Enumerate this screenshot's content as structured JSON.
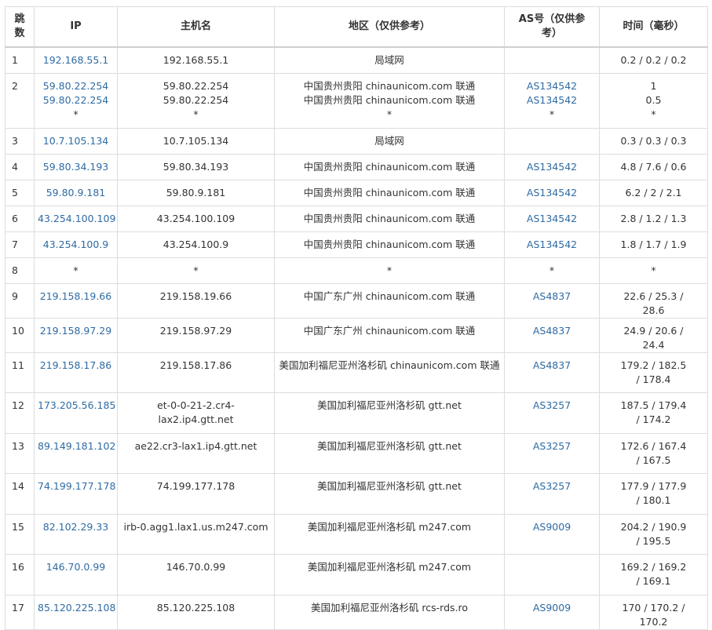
{
  "headers": [
    "跳数",
    "IP",
    "主机名",
    "地区（仅供参考）",
    "AS号（仅供参考）",
    "时间（毫秒）"
  ],
  "rows": [
    {
      "hop": "1",
      "ip": [
        "192.168.55.1"
      ],
      "host": [
        "192.168.55.1"
      ],
      "region": [
        "局域网"
      ],
      "asn": [],
      "time": [
        "0.2 / 0.2 / 0.2"
      ]
    },
    {
      "hop": "2",
      "ip": [
        "59.80.22.254",
        "59.80.22.254",
        "*"
      ],
      "host": [
        "59.80.22.254",
        "59.80.22.254",
        "*"
      ],
      "region": [
        "中国贵州贵阳 chinaunicom.com 联通",
        "中国贵州贵阳 chinaunicom.com 联通",
        "*"
      ],
      "asn": [
        "AS134542",
        "AS134542",
        "*"
      ],
      "time": [
        "1",
        "0.5",
        "*"
      ]
    },
    {
      "hop": "3",
      "ip": [
        "10.7.105.134"
      ],
      "host": [
        "10.7.105.134"
      ],
      "region": [
        "局域网"
      ],
      "asn": [],
      "time": [
        "0.3 / 0.3 / 0.3"
      ]
    },
    {
      "hop": "4",
      "ip": [
        "59.80.34.193"
      ],
      "host": [
        "59.80.34.193"
      ],
      "region": [
        "中国贵州贵阳 chinaunicom.com 联通"
      ],
      "asn": [
        "AS134542"
      ],
      "time": [
        "4.8 / 7.6 / 0.6"
      ]
    },
    {
      "hop": "5",
      "ip": [
        "59.80.9.181"
      ],
      "host": [
        "59.80.9.181"
      ],
      "region": [
        "中国贵州贵阳 chinaunicom.com 联通"
      ],
      "asn": [
        "AS134542"
      ],
      "time": [
        "6.2 / 2 / 2.1"
      ]
    },
    {
      "hop": "6",
      "ip": [
        "43.254.100.109"
      ],
      "host": [
        "43.254.100.109"
      ],
      "region": [
        "中国贵州贵阳 chinaunicom.com 联通"
      ],
      "asn": [
        "AS134542"
      ],
      "time": [
        "2.8 / 1.2 / 1.3"
      ]
    },
    {
      "hop": "7",
      "ip": [
        "43.254.100.9"
      ],
      "host": [
        "43.254.100.9"
      ],
      "region": [
        "中国贵州贵阳 chinaunicom.com 联通"
      ],
      "asn": [
        "AS134542"
      ],
      "time": [
        "1.8 / 1.7 / 1.9"
      ]
    },
    {
      "hop": "8",
      "ip": [
        "*"
      ],
      "host": [
        "*"
      ],
      "region": [
        "*"
      ],
      "asn": [
        "*"
      ],
      "time": [
        "*"
      ]
    },
    {
      "hop": "9",
      "ip": [
        "219.158.19.66"
      ],
      "host": [
        "219.158.19.66"
      ],
      "region": [
        "中国广东广州 chinaunicom.com 联通"
      ],
      "asn": [
        "AS4837"
      ],
      "time": [
        "22.6 / 25.3 / 28.6"
      ]
    },
    {
      "hop": "10",
      "ip": [
        "219.158.97.29"
      ],
      "host": [
        "219.158.97.29"
      ],
      "region": [
        "中国广东广州 chinaunicom.com 联通"
      ],
      "asn": [
        "AS4837"
      ],
      "time": [
        "24.9 / 20.6 / 24.4"
      ]
    },
    {
      "hop": "11",
      "ip": [
        "219.158.17.86"
      ],
      "host": [
        "219.158.17.86"
      ],
      "region": [
        "美国加利福尼亚州洛杉矶 chinaunicom.com 联通"
      ],
      "asn": [
        "AS4837"
      ],
      "time": [
        "179.2 / 182.5 / 178.4"
      ]
    },
    {
      "hop": "12",
      "ip": [
        "173.205.56.185"
      ],
      "host": [
        "et-0-0-21-2.cr4-lax2.ip4.gtt.net"
      ],
      "region": [
        "美国加利福尼亚州洛杉矶 gtt.net"
      ],
      "asn": [
        "AS3257"
      ],
      "time": [
        "187.5 / 179.4 / 174.2"
      ]
    },
    {
      "hop": "13",
      "ip": [
        "89.149.181.102"
      ],
      "host": [
        "ae22.cr3-lax1.ip4.gtt.net"
      ],
      "region": [
        "美国加利福尼亚州洛杉矶 gtt.net"
      ],
      "asn": [
        "AS3257"
      ],
      "time": [
        "172.6 / 167.4 / 167.5"
      ]
    },
    {
      "hop": "14",
      "ip": [
        "74.199.177.178"
      ],
      "host": [
        "74.199.177.178"
      ],
      "region": [
        "美国加利福尼亚州洛杉矶 gtt.net"
      ],
      "asn": [
        "AS3257"
      ],
      "time": [
        "177.9 / 177.9 / 180.1"
      ]
    },
    {
      "hop": "15",
      "ip": [
        "82.102.29.33"
      ],
      "host": [
        "irb-0.agg1.lax1.us.m247.com"
      ],
      "region": [
        "美国加利福尼亚州洛杉矶 m247.com"
      ],
      "asn": [
        "AS9009"
      ],
      "time": [
        "204.2 / 190.9 / 195.5"
      ]
    },
    {
      "hop": "16",
      "ip": [
        "146.70.0.99"
      ],
      "host": [
        "146.70.0.99"
      ],
      "region": [
        "美国加利福尼亚州洛杉矶 m247.com"
      ],
      "asn": [],
      "time": [
        "169.2 / 169.2 / 169.1"
      ]
    },
    {
      "hop": "17",
      "ip": [
        "85.120.225.108"
      ],
      "host": [
        "85.120.225.108"
      ],
      "region": [
        "美国加利福尼亚州洛杉矶 rcs-rds.ro"
      ],
      "asn": [
        "AS9009"
      ],
      "time": [
        "170 / 170.2 / 170.2"
      ]
    }
  ],
  "colors": {
    "link": "#2f6ba3",
    "border": "#dddddd",
    "text": "#333333"
  }
}
